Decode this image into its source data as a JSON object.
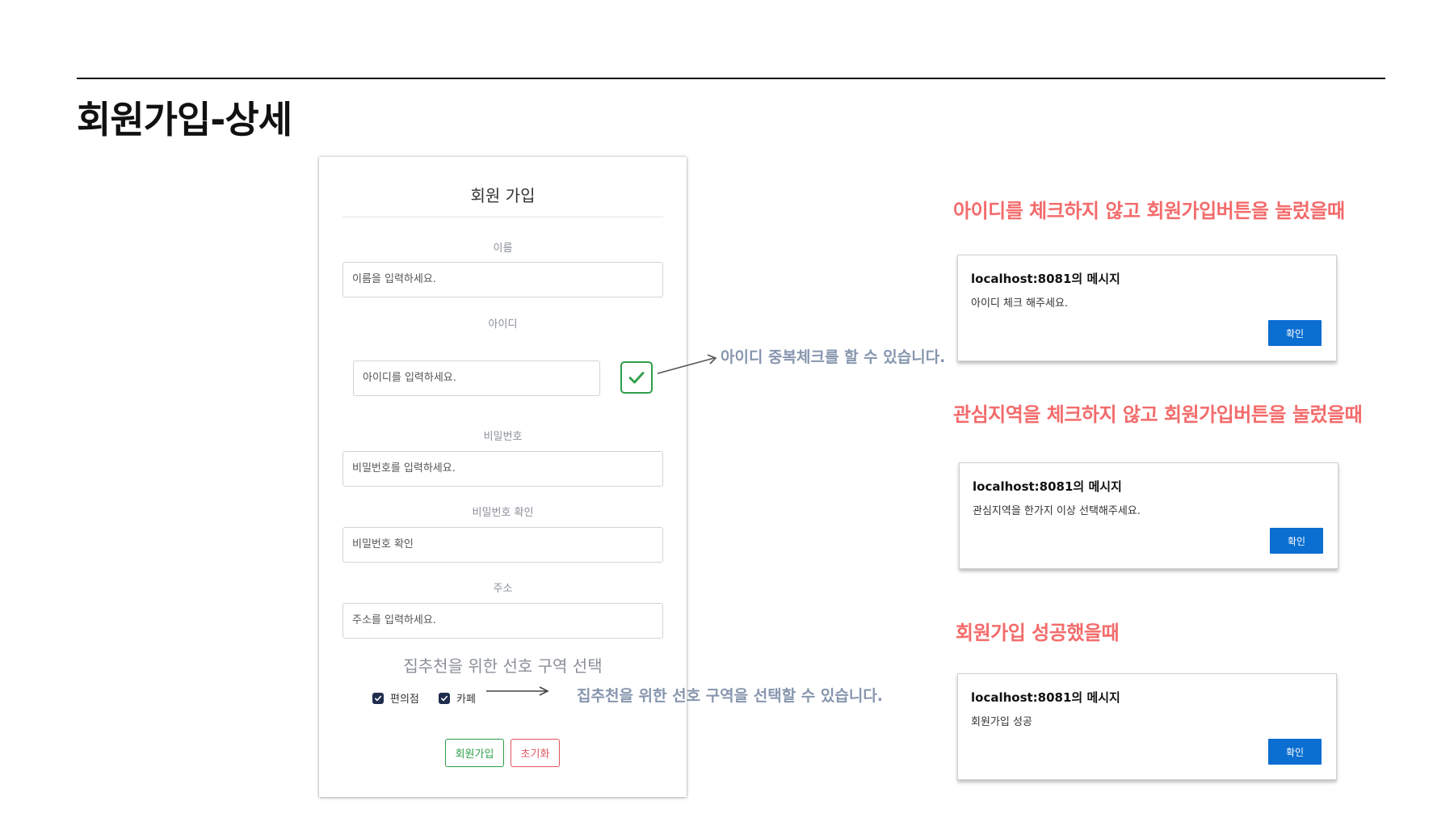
{
  "slide": {
    "title": "회원가입-상세"
  },
  "signup_form": {
    "title": "회원 가입",
    "fields": [
      {
        "label": "이름",
        "placeholder": "이름을 입력하세요."
      },
      {
        "label": "아이디",
        "placeholder": "아이디를 입력하세요."
      },
      {
        "label": "비밀번호",
        "placeholder": "비밀번호를 입력하세요."
      },
      {
        "label": "비밀번호 확인",
        "placeholder": "비밀번호 확인"
      },
      {
        "label": "주소",
        "placeholder": "주소를 입력하세요."
      }
    ],
    "preference_title": "집추천을 위한 선호 구역 선택",
    "checkboxes": [
      {
        "label": "편의점",
        "checked": true
      },
      {
        "label": "카페",
        "checked": true
      }
    ],
    "signup_button": "회원가입",
    "reset_button": "초기화"
  },
  "annotations": {
    "id_check_note": "아이디 중복체크를 할 수 있습니다.",
    "preference_note": "집추천을 위한 선호 구역을 선택할 수 있습니다."
  },
  "scenarios": [
    {
      "heading": "아이디를 체크하지 않고 회원가입버튼을 눌렀을때",
      "dialog_title": "localhost:8081의 메시지",
      "dialog_message": "아이디 체크 해주세요.",
      "ok_label": "확인"
    },
    {
      "heading": "관심지역을 체크하지 않고 회원가입버튼을 눌렀을때",
      "dialog_title": "localhost:8081의 메시지",
      "dialog_message": "관심지역을 한가지 이상 선택해주세요.",
      "ok_label": "확인"
    },
    {
      "heading": "회원가입 성공했을때",
      "dialog_title": "localhost:8081의 메시지",
      "dialog_message": "회원가입 성공",
      "ok_label": "확인"
    }
  ],
  "colors": {
    "accent_red": "#f36b6b",
    "note_gray_blue": "#8796ae",
    "success_green": "#2e9e48",
    "dialog_button_blue": "#0b6ed1"
  }
}
